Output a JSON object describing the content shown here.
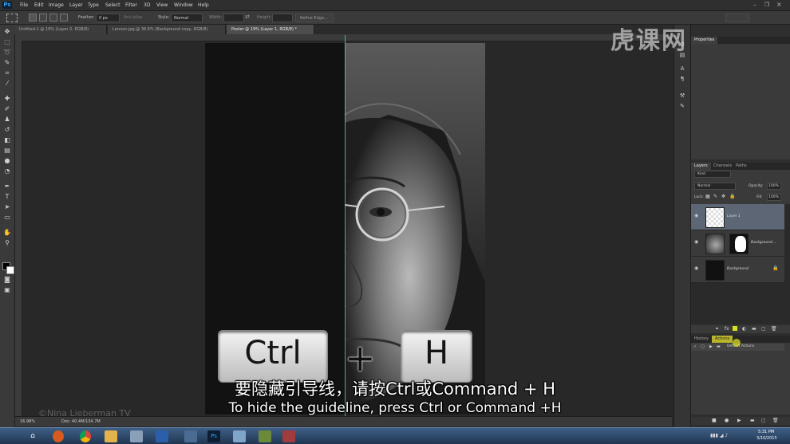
{
  "app": {
    "logo": "Ps"
  },
  "menu": [
    "File",
    "Edit",
    "Image",
    "Layer",
    "Type",
    "Select",
    "Filter",
    "3D",
    "View",
    "Window",
    "Help"
  ],
  "options": {
    "feather_label": "Feather:",
    "feather_value": "0 px",
    "antialias_label": "Anti-alias",
    "style_label": "Style:",
    "style_value": "Normal",
    "width_label": "Width:",
    "height_label": "Height:",
    "refine_button": "Refine Edge..."
  },
  "tabs": [
    {
      "label": "Untitled-1 @ 19% (Layer 2, RGB/8)"
    },
    {
      "label": "Lennon.jpg @ 36.6% (Background copy, RGB/8)"
    },
    {
      "label": "Poster @ 19% (Layer 1, RGB/8) *"
    }
  ],
  "status": {
    "zoom": "16.98%",
    "doc": "Doc: 40.4M/134.7M"
  },
  "overlay": {
    "key_ctrl": "Ctrl",
    "plus": "+",
    "key_h": "H",
    "subtitle_cn": "要隐藏引导线，请按Ctrl或Command + H",
    "subtitle_en": "To hide the guideline, press Ctrl or Command +H",
    "watermark": "虎课网",
    "watermark2": "©Nina Lieberman TV"
  },
  "panels": {
    "properties_header": "Properties",
    "layers_tabs": [
      "Layers",
      "Channels",
      "Paths"
    ],
    "kind_label": "Kind",
    "blend_mode": "Normal",
    "opacity_label": "Opacity:",
    "opacity_value": "100%",
    "lock_label": "Lock:",
    "fill_label": "Fill:",
    "fill_value": "100%",
    "layers": [
      {
        "name": "Layer 1"
      },
      {
        "name": "Background ..."
      },
      {
        "name": "Background"
      }
    ],
    "bottom_tabs": [
      "History",
      "Actions"
    ],
    "actions_item": "Default Actions"
  },
  "taskbar": {
    "time": "5:31 PM",
    "date": "3/10/2015"
  }
}
